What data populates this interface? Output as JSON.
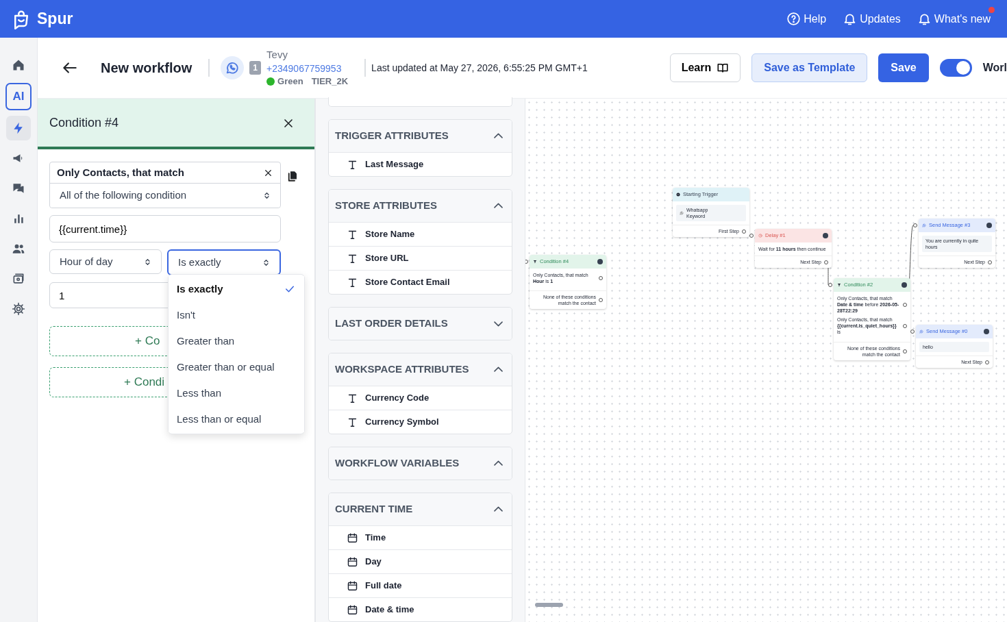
{
  "topbar": {
    "brand": "Spur",
    "links": [
      {
        "label": "Help",
        "kind": "help",
        "dot": false
      },
      {
        "label": "Updates",
        "kind": "bell",
        "dot": false
      },
      {
        "label": "What's new",
        "kind": "bell",
        "dot": true
      }
    ]
  },
  "sidebar": {
    "items": [
      {
        "kind": "home",
        "selected": false
      },
      {
        "kind": "ai",
        "label": "AI",
        "selected": false
      },
      {
        "kind": "bolt",
        "selected": true
      },
      {
        "kind": "megaphone",
        "selected": false
      },
      {
        "kind": "chat",
        "selected": false
      },
      {
        "kind": "chart",
        "selected": false
      },
      {
        "kind": "people",
        "selected": false
      },
      {
        "kind": "media",
        "selected": false
      },
      {
        "kind": "gear",
        "selected": false
      }
    ]
  },
  "header": {
    "title": "New workflow",
    "badge": "1",
    "contact_name": "Tevy",
    "phone": "+2349067759953",
    "quality": "Green",
    "tier": "TIER_2K",
    "last_updated": "Last updated at May 27, 2026, 6:55:25 PM GMT+1",
    "learn": "Learn",
    "save_template": "Save as Template",
    "save": "Save",
    "toggle": {
      "on": true,
      "label": "Worl"
    }
  },
  "condition_panel": {
    "title": "Condition #4",
    "group_label": "Only Contacts, that match",
    "match_select": "All of the following condition",
    "variable": "{{current.time}}",
    "field_select": "Hour of day",
    "operator_select": "Is exactly",
    "value": "1",
    "add_buttons": [
      "+ Co",
      "+ Condi"
    ],
    "operator_menu": [
      {
        "label": "Is exactly",
        "selected": true
      },
      {
        "label": "Isn't",
        "selected": false
      },
      {
        "label": "Greater than",
        "selected": false
      },
      {
        "label": "Greater than or equal",
        "selected": false
      },
      {
        "label": "Less than",
        "selected": false
      },
      {
        "label": "Less than or equal",
        "selected": false
      }
    ]
  },
  "variables": [
    {
      "title": "TRIGGER ATTRIBUTES",
      "expanded": true,
      "items": [
        {
          "label": "Last Message",
          "kind": "text"
        }
      ]
    },
    {
      "title": "STORE ATTRIBUTES",
      "expanded": true,
      "items": [
        {
          "label": "Store Name",
          "kind": "text"
        },
        {
          "label": "Store URL",
          "kind": "text"
        },
        {
          "label": "Store Contact Email",
          "kind": "text"
        }
      ]
    },
    {
      "title": "LAST ORDER DETAILS",
      "expanded": false
    },
    {
      "title": "WORKSPACE ATTRIBUTES",
      "expanded": true,
      "items": [
        {
          "label": "Currency Code",
          "kind": "text"
        },
        {
          "label": "Currency Symbol",
          "kind": "text"
        }
      ]
    },
    {
      "title": "WORKFLOW VARIABLES",
      "expanded": true
    },
    {
      "title": "CURRENT TIME",
      "expanded": true,
      "items": [
        {
          "label": "Time",
          "kind": "date"
        },
        {
          "label": "Day",
          "kind": "date"
        },
        {
          "label": "Full date",
          "kind": "date"
        },
        {
          "label": "Date & time",
          "kind": "date"
        }
      ]
    }
  ],
  "nodes": [
    {
      "kind": "trigger",
      "title": "Starting Trigger",
      "box": [
        "Whatsapp",
        "Keyword"
      ],
      "outputs": [
        "First Step"
      ]
    },
    {
      "kind": "condition",
      "title": "Condition #4",
      "conditions": [
        {
          "label": "Only Contacts, that match",
          "rule": "**Hour** is **1**"
        }
      ],
      "outputs": [
        "None of these conditions match the contact"
      ]
    },
    {
      "kind": "delay",
      "title": "Delay #1",
      "text": "Wait for **11 hours** then continue",
      "outputs": [
        "Next Step"
      ]
    },
    {
      "kind": "condition",
      "title": "Condition #2",
      "conditions": [
        {
          "label": "Only Contacts, that match",
          "rule": "**Date & time** before **2026-05-28T22:29**"
        },
        {
          "label": "Only Contacts, that match",
          "rule": "**{{current.is_quiet_hours}}** is"
        }
      ],
      "outputs": [
        "None of these conditions match the contact"
      ]
    },
    {
      "kind": "message",
      "title": "Send Message #3",
      "box": [
        "You are currently in quite hours"
      ],
      "outputs": [
        "Next Step"
      ]
    },
    {
      "kind": "message",
      "title": "Send Message #0",
      "box": [
        "hello"
      ],
      "outputs": [
        "Next Step"
      ]
    }
  ]
}
